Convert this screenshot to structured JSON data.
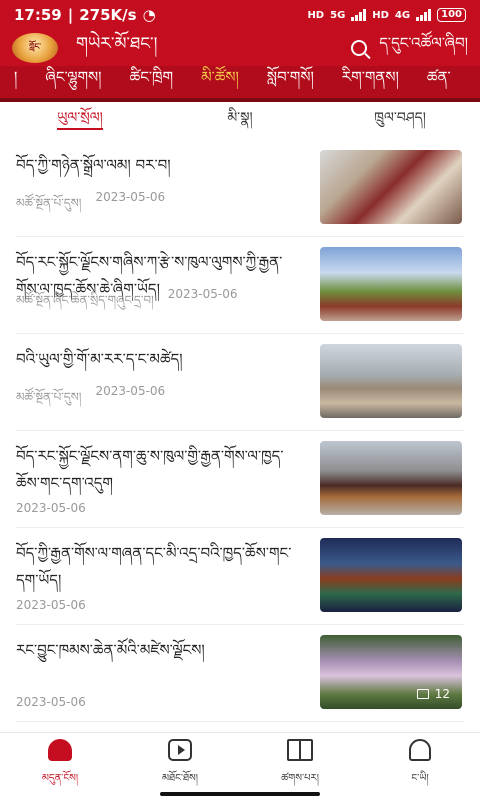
{
  "status_bar": {
    "time": "17:59",
    "speed": "275K/s",
    "hd1": "HD",
    "net1": "5G",
    "hd2": "HD",
    "net2": "4G",
    "battery": "100"
  },
  "app_bar": {
    "logo_text": "ཀློང་",
    "title": "གཡེར་མོ་ཐང་།",
    "search_label": "ད་དུང་འཚོལ་ཞིབ།"
  },
  "categories": [
    {
      "label": "།"
    },
    {
      "label": "ཞིང་ལྷུགས།"
    },
    {
      "label": "ཚིང་ཁྲིག"
    },
    {
      "label": "མི་ཚོས།"
    },
    {
      "label": "སློབ་གསོ།"
    },
    {
      "label": "རིག་གནས།"
    },
    {
      "label": "ཚན་"
    }
  ],
  "sub_tabs": [
    {
      "label": "ཡུལ་སྲོལ།"
    },
    {
      "label": "མི་སྣ།"
    },
    {
      "label": "ཁྲུལ་བཤད།"
    }
  ],
  "articles": [
    {
      "title": "བོད་ཀྱི་གཉེན་སྒྲོལ་ལམ། བར་བ།",
      "source": "མཚོ་སྔོན་པོ་དུས།",
      "date": "2023-05-06",
      "photo_count": ""
    },
    {
      "title": "བོད་རང་སྐྱོང་ལྗོངས་གཞིས་ཀ་རྩེ་ས་ཁུལ་ལུགས་ཀྱི་རྒྱན་གོས་ལ་ཁྱད་ཆོས་ཆེ་ཞིག་ཡོད།",
      "source": "མཚོ་སྔོན་ཞིང་ཆེན་སྲིད་གཞུང་དྲ་བ།",
      "date": "2023-05-06",
      "photo_count": ""
    },
    {
      "title": "བའི་ཡུལ་གྱི་གོ་མ་རར་ད་ང་མཚེད།",
      "source": "མཚོ་སྔོན་པོ་དུས།",
      "date": "2023-05-06",
      "photo_count": ""
    },
    {
      "title": "བོད་རང་སྐྱོང་ལྗོངས་ནག་ཆུ་ས་ཁུལ་གྱི་རྒྱན་གོས་ལ་ཁྱད་ཆོས་གང་དག་འདུག",
      "source": "",
      "date": "2023-05-06",
      "photo_count": ""
    },
    {
      "title": "བོད་ཀྱི་རྒྱན་གོས་ལ་གཞན་དང་མི་འདྲ་བའི་ཁྱད་ཆོས་གང་དག་ཡོད།",
      "source": "",
      "date": "2023-05-06",
      "photo_count": ""
    },
    {
      "title": "རང་བྱུང་ཁམས་ཆེན་མོའི་མཛེས་ལྗོངས།",
      "source": "",
      "date": "2023-05-06",
      "photo_count": "12"
    }
  ],
  "bottom_nav": [
    {
      "label": "མདུན་ངོས།"
    },
    {
      "label": "མཐོང་ཐོས།"
    },
    {
      "label": "ཚགས་པར།"
    },
    {
      "label": "ང་ཡི།"
    }
  ]
}
